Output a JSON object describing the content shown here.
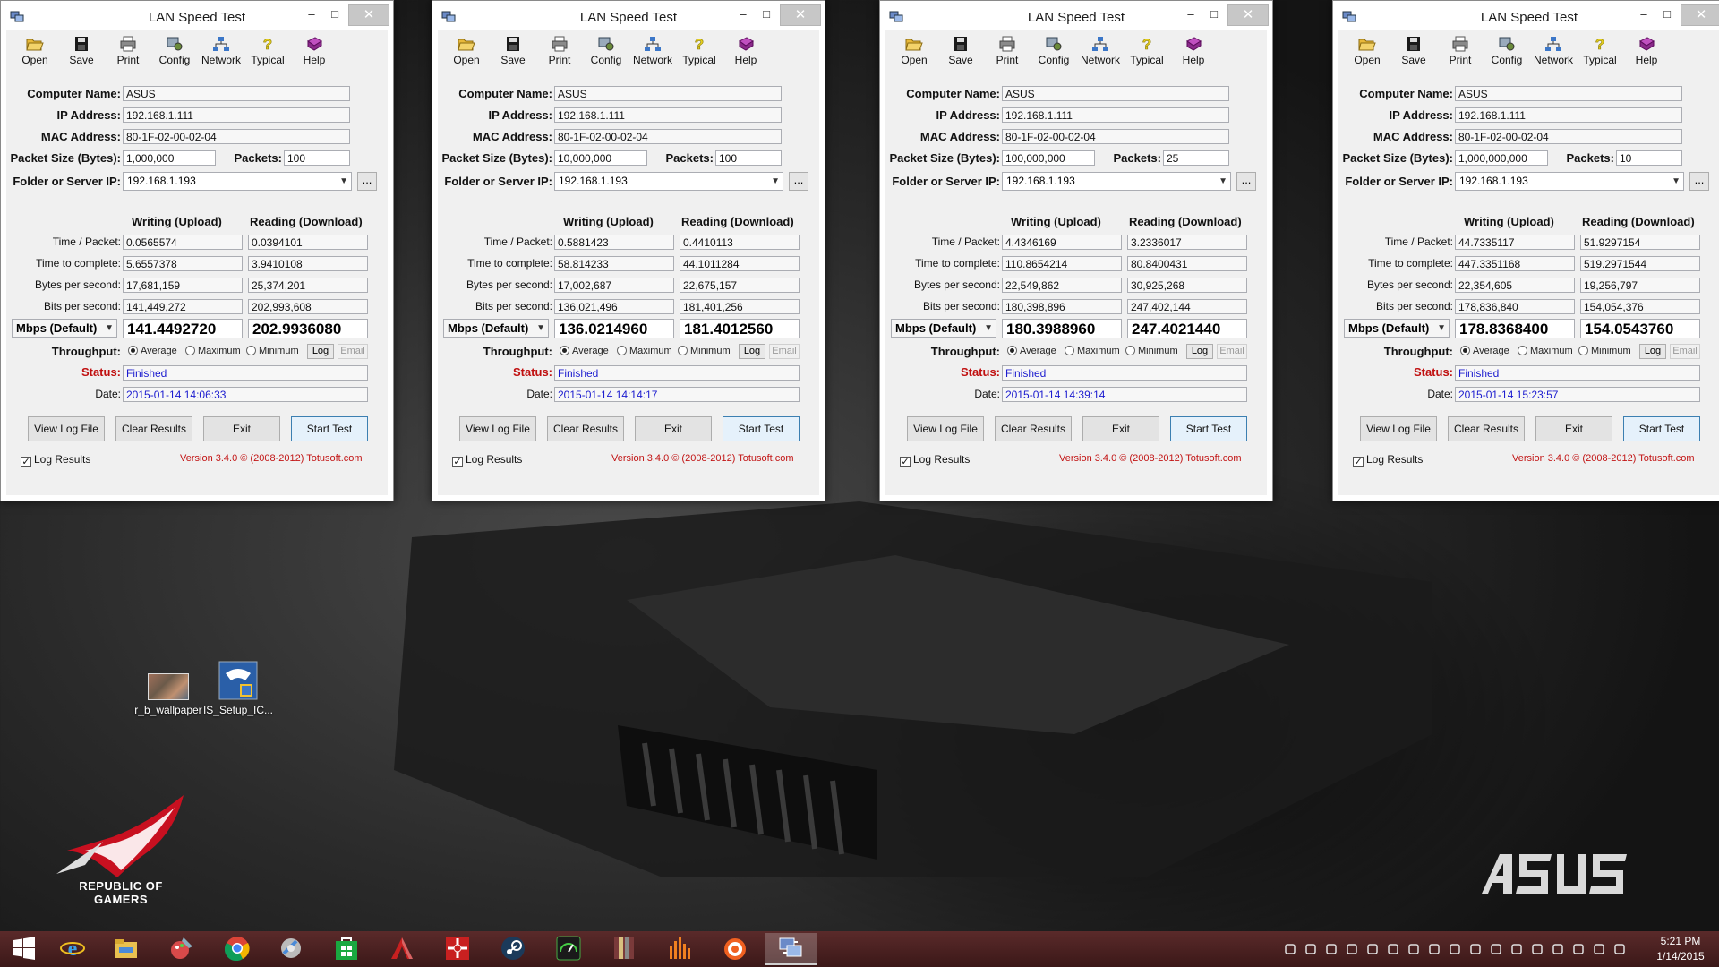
{
  "app": {
    "title": "LAN Speed Test",
    "toolbar": [
      "Open",
      "Save",
      "Print",
      "Config",
      "Network",
      "Typical",
      "Help"
    ],
    "labels": {
      "computer_name": "Computer Name:",
      "ip_address": "IP Address:",
      "mac_address": "MAC Address:",
      "packet_size": "Packet Size (Bytes):",
      "packets": "Packets:",
      "folder": "Folder or Server IP:",
      "writing": "Writing (Upload)",
      "reading": "Reading (Download)",
      "time_packet": "Time / Packet:",
      "time_complete": "Time to complete:",
      "bytes_sec": "Bytes per second:",
      "bits_sec": "Bits per second:",
      "throughput": "Throughput:",
      "status": "Status:",
      "date": "Date:",
      "average": "Average",
      "maximum": "Maximum",
      "minimum": "Minimum",
      "log": "Log",
      "email": "Email",
      "view_log": "View Log File",
      "clear_results": "Clear Results",
      "exit": "Exit",
      "start_test": "Start Test",
      "log_results": "Log Results",
      "version": "Version 3.4.0  © (2008-2012) Totusoft.com",
      "browse": "...",
      "units": "Mbps (Default)"
    },
    "windows": [
      {
        "computer_name": "ASUS",
        "ip": "192.168.1.111",
        "mac": "80-1F-02-00-02-04",
        "packet_size": "1,000,000",
        "packets": "100",
        "folder": "192.168.1.193",
        "w_time_packet": "0.0565574",
        "r_time_packet": "0.0394101",
        "w_time_complete": "5.6557378",
        "r_time_complete": "3.9410108",
        "w_bytes": "17,681,159",
        "r_bytes": "25,374,201",
        "w_bits": "141,449,272",
        "r_bits": "202,993,608",
        "w_mbps": "141.4492720",
        "r_mbps": "202.9936080",
        "status": "Finished",
        "date": "2015-01-14 14:06:33"
      },
      {
        "computer_name": "ASUS",
        "ip": "192.168.1.111",
        "mac": "80-1F-02-00-02-04",
        "packet_size": "10,000,000",
        "packets": "100",
        "folder": "192.168.1.193",
        "w_time_packet": "0.5881423",
        "r_time_packet": "0.4410113",
        "w_time_complete": "58.814233",
        "r_time_complete": "44.1011284",
        "w_bytes": "17,002,687",
        "r_bytes": "22,675,157",
        "w_bits": "136,021,496",
        "r_bits": "181,401,256",
        "w_mbps": "136.0214960",
        "r_mbps": "181.4012560",
        "status": "Finished",
        "date": "2015-01-14 14:14:17"
      },
      {
        "computer_name": "ASUS",
        "ip": "192.168.1.111",
        "mac": "80-1F-02-00-02-04",
        "packet_size": "100,000,000",
        "packets": "25",
        "folder": "192.168.1.193",
        "w_time_packet": "4.4346169",
        "r_time_packet": "3.2336017",
        "w_time_complete": "110.8654214",
        "r_time_complete": "80.8400431",
        "w_bytes": "22,549,862",
        "r_bytes": "30,925,268",
        "w_bits": "180,398,896",
        "r_bits": "247,402,144",
        "w_mbps": "180.3988960",
        "r_mbps": "247.4021440",
        "status": "Finished",
        "date": "2015-01-14 14:39:14"
      },
      {
        "computer_name": "ASUS",
        "ip": "192.168.1.111",
        "mac": "80-1F-02-00-02-04",
        "packet_size": "1,000,000,000",
        "packets": "10",
        "folder": "192.168.1.193",
        "w_time_packet": "44.7335117",
        "r_time_packet": "51.9297154",
        "w_time_complete": "447.3351168",
        "r_time_complete": "519.2971544",
        "w_bytes": "22,354,605",
        "r_bytes": "19,256,797",
        "w_bits": "178,836,840",
        "r_bits": "154,054,376",
        "w_mbps": "178.8368400",
        "r_mbps": "154.0543760",
        "status": "Finished",
        "date": "2015-01-14 15:23:57"
      }
    ]
  },
  "desktop": {
    "icons": [
      {
        "label": "r_b_wallpaper",
        "icon": "image-thumbnail-icon"
      },
      {
        "label": "IS_Setup_IC...",
        "icon": "installer-icon"
      }
    ],
    "rog_text": [
      "REPUBLIC OF",
      "GAMERS"
    ],
    "brand_logo": "ASUS"
  },
  "taskbar": {
    "apps": [
      "start-icon",
      "internet-explorer-icon",
      "file-explorer-icon",
      "paint-icon",
      "chrome-icon",
      "settings-tool-icon",
      "store-icon",
      "autocad-icon",
      "game-app-icon",
      "steam-icon",
      "speedometer-app-icon",
      "archive-app-icon",
      "audio-equalizer-icon",
      "media-player-icon",
      "lan-speed-test-icon"
    ],
    "active_app": "lan-speed-test-icon",
    "clock_time": "5:21 PM",
    "clock_date": "1/14/2015"
  },
  "colors": {
    "status_red": "#c01010",
    "value_blue": "#1b1bcf",
    "taskbar": "#4a2222"
  }
}
